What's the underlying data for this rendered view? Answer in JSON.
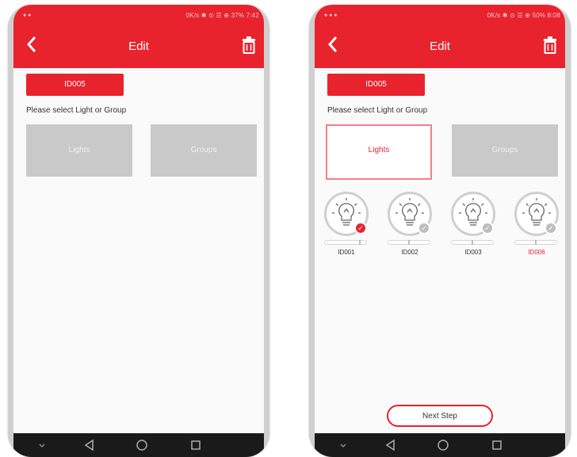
{
  "left": {
    "status_text": "0K/s ✱ ⊙ ☰ ⊕ 37% 7:42",
    "title": "Edit",
    "id_label": "ID005",
    "prompt": "Please select Light or Group",
    "lights_label": "Lights",
    "groups_label": "Groups"
  },
  "right": {
    "status_text": "0K/s ✱ ⊙ ☰ ⊕ 50% 8:08",
    "title": "Edit",
    "id_label": "ID005",
    "prompt": "Please select Light or Group",
    "lights_label": "Lights",
    "groups_label": "Groups",
    "bulbs": [
      {
        "label": "ID001",
        "selected": true,
        "level": 0.85
      },
      {
        "label": "ID002",
        "selected": false,
        "level": 0.5
      },
      {
        "label": "ID003",
        "selected": false,
        "level": 0.5
      },
      {
        "label": "ID006",
        "selected": false,
        "level": 0.5
      }
    ],
    "next_label": "Next Step"
  },
  "colors": {
    "accent": "#e8232d",
    "tile_grey": "#c9c9c9",
    "navbar": "#1a1a1a"
  },
  "icons": {
    "back": "back-chevron-icon",
    "trash": "trash-icon",
    "bulb": "bulb-icon",
    "check": "check-icon",
    "nav": [
      "nav-down-icon",
      "nav-back-icon",
      "nav-home-icon",
      "nav-recent-icon"
    ]
  }
}
